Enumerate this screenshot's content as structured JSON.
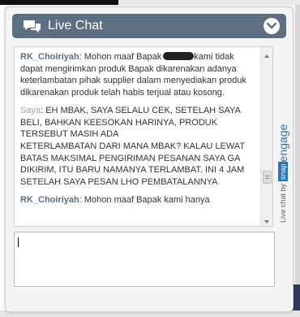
{
  "header": {
    "title": "Live Chat",
    "chat_icon": "chat-bubbles-icon",
    "collapse_icon": "chevron-down-icon",
    "color": "#5d6f80"
  },
  "messages": [
    {
      "sender": "RK_Choiriyah",
      "role": "agent",
      "text_before_redaction": "Mohon maaf Bapak",
      "text": "kami tidak dapat mengirimkan produk Bapak dikarenakan adanya keterlambatan pihak supplier dalam menyediakan produk dikarenakan produk telah habis terjual atau kosong."
    },
    {
      "sender": "Saya",
      "role": "user",
      "text": "EH MBAK, SAYA SELALU CEK, SETELAH SAYA BELI, BAHKAN KEESOKAN HARINYA, PRODUK TERSEBUT MASIH ADA\nKETERLAMBATAN DARI MANA MBAK? KALAU LEWAT BATAS MAKSIMAL PENGIRIMAN PESANAN SAYA GA DIKIRIM, ITU BARU NAMANYA TERLAMBAT. INI 4 JAM SETELAH SAYA PESAN LHO PEMBATALANNYA"
    },
    {
      "sender": "RK_Choiriyah",
      "role": "agent",
      "text": "Mohon maaf Bapak kami hanya"
    }
  ],
  "branding": {
    "by_text": "Live chat by",
    "snap_text": "snap",
    "engage_text": "engage",
    "color": "#2e73b8"
  },
  "input": {
    "value": ""
  }
}
